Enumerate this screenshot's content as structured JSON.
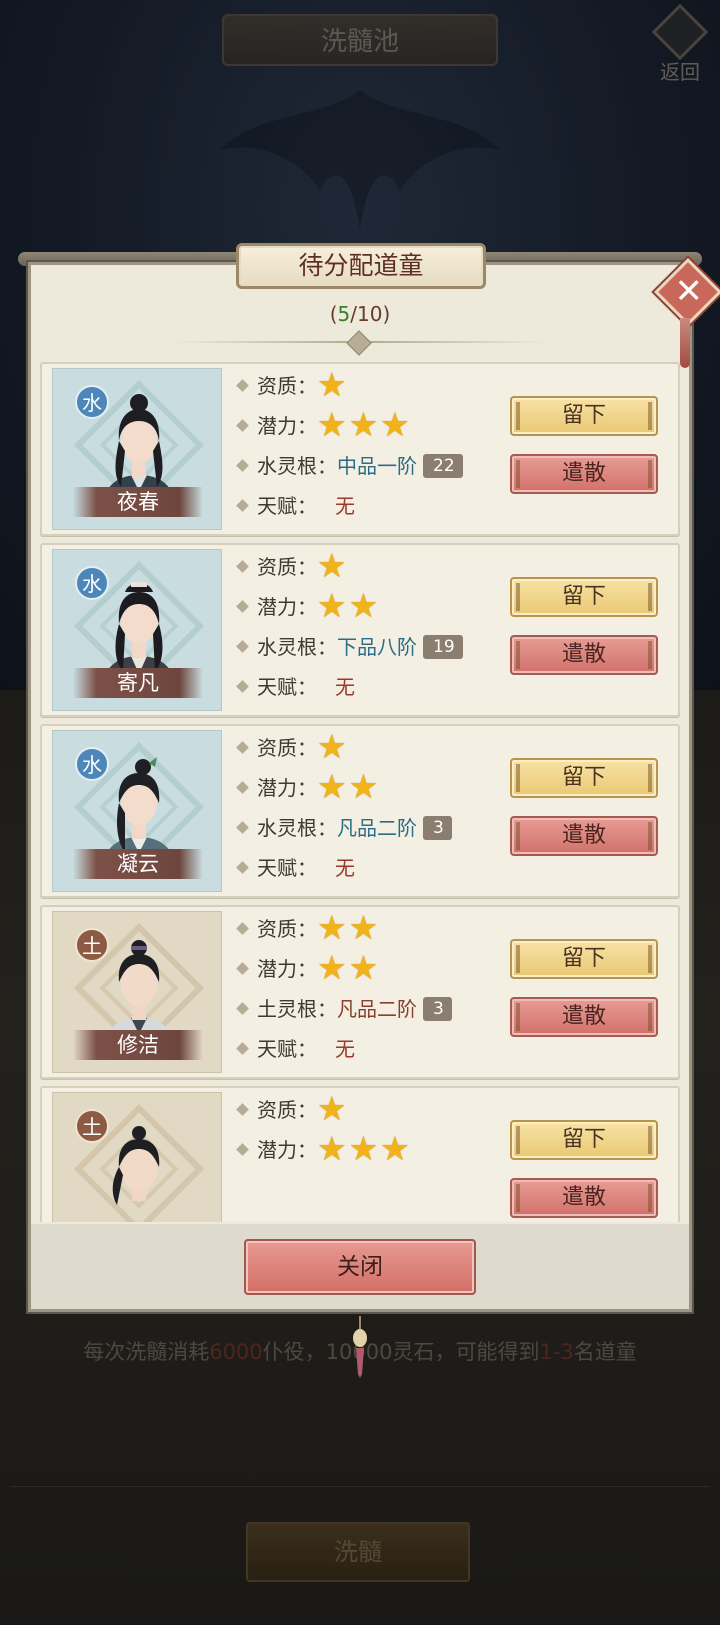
{
  "header": {
    "title": "洗髓池",
    "back_label": "返回"
  },
  "footer": {
    "cost_prefix": "每次洗髓消耗",
    "cost_servants": "6000",
    "cost_mid": "仆役，10000灵石，可能得到",
    "cost_count": "1-3",
    "cost_suffix": "名道童",
    "wash_label": "洗髓"
  },
  "dialog": {
    "title": "待分配道童",
    "count_current": "5",
    "count_total": "10",
    "close_label": "关闭",
    "labels": {
      "aptitude": "资质：",
      "potential": "潜力：",
      "talent": "天赋：",
      "keep": "留下",
      "dismiss": "遣散"
    }
  },
  "disciples": [
    {
      "name": "夜春",
      "element": "水",
      "element_type": "water",
      "aptitude": 1,
      "aptitude_stars": "★",
      "potential": 3,
      "potential_stars": "★★★",
      "root_label": "水灵根：",
      "root_grade": "中品一阶",
      "level": "22",
      "talent": "无"
    },
    {
      "name": "寄凡",
      "element": "水",
      "element_type": "water",
      "aptitude": 1,
      "aptitude_stars": "★",
      "potential": 2,
      "potential_stars": "★★",
      "root_label": "水灵根：",
      "root_grade": "下品八阶",
      "level": "19",
      "talent": "无"
    },
    {
      "name": "凝云",
      "element": "水",
      "element_type": "water",
      "aptitude": 1,
      "aptitude_stars": "★",
      "potential": 2,
      "potential_stars": "★★",
      "root_label": "水灵根：",
      "root_grade": "凡品二阶",
      "level": "3",
      "talent": "无"
    },
    {
      "name": "修洁",
      "element": "土",
      "element_type": "earth",
      "aptitude": 2,
      "aptitude_stars": "★★",
      "potential": 2,
      "potential_stars": "★★",
      "root_label": "土灵根：",
      "root_grade": "凡品二阶",
      "level": "3",
      "talent": "无"
    },
    {
      "name": "",
      "element": "土",
      "element_type": "earth",
      "aptitude": 1,
      "aptitude_stars": "★",
      "potential": 3,
      "potential_stars": "★★★",
      "root_label": "",
      "root_grade": "",
      "level": "",
      "talent": ""
    }
  ],
  "colors": {
    "water_badge": "#4d86b8",
    "earth_badge": "#8d5a43",
    "star": "#f1b319",
    "keep_button": "#f0d38c",
    "dismiss_button": "#dc857e"
  }
}
